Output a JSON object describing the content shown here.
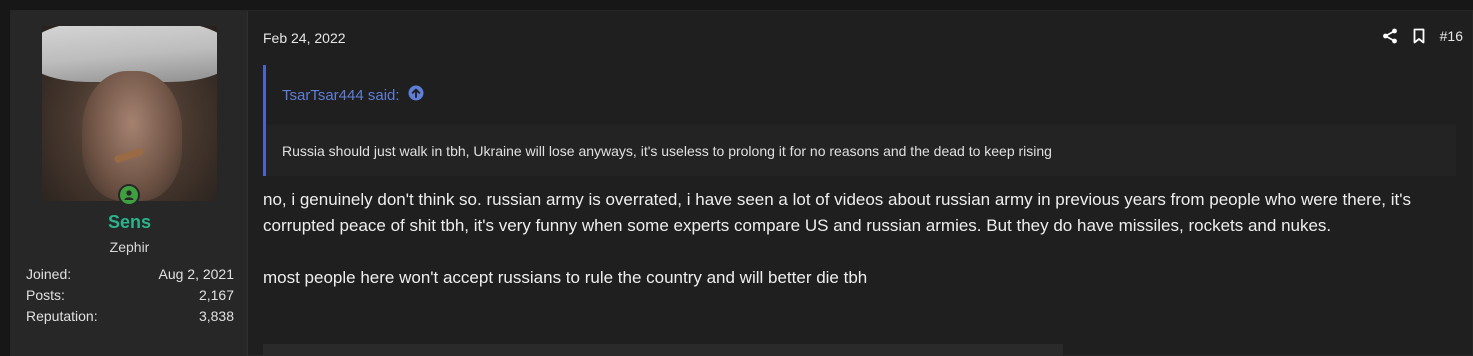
{
  "user": {
    "name": "Sens",
    "title": "Zephir",
    "stats": [
      {
        "label": "Joined:",
        "value": "Aug 2, 2021"
      },
      {
        "label": "Posts:",
        "value": "2,167"
      },
      {
        "label": "Reputation:",
        "value": "3,838"
      }
    ],
    "online_icon": "user-online-icon"
  },
  "post": {
    "date": "Feb 24, 2022",
    "number": "#16",
    "actions": {
      "share_icon": "share-icon",
      "bookmark_icon": "bookmark-icon"
    },
    "quote": {
      "author": "TsarTsar444 said:",
      "text": "Russia should just walk in tbh, Ukraine will lose anyways, it's useless to prolong it for no reasons and the dead to keep rising",
      "jump_icon": "arrow-up-circle-icon"
    },
    "message": [
      "no, i genuinely don't think so. russian army is overrated, i have seen a lot of videos about russian army in previous years from people who were there, it's corrupted peace of shit tbh, it's very funny when some experts compare US and russian armies. But they do have missiles, rockets and nukes.",
      "most people here won't accept russians to rule the country and will better die tbh"
    ]
  },
  "colors": {
    "background": "#171717",
    "username": "#2bb38a",
    "quote_accent": "#4a64c8",
    "quote_author": "#5f7ed8",
    "online": "#3fa040"
  }
}
